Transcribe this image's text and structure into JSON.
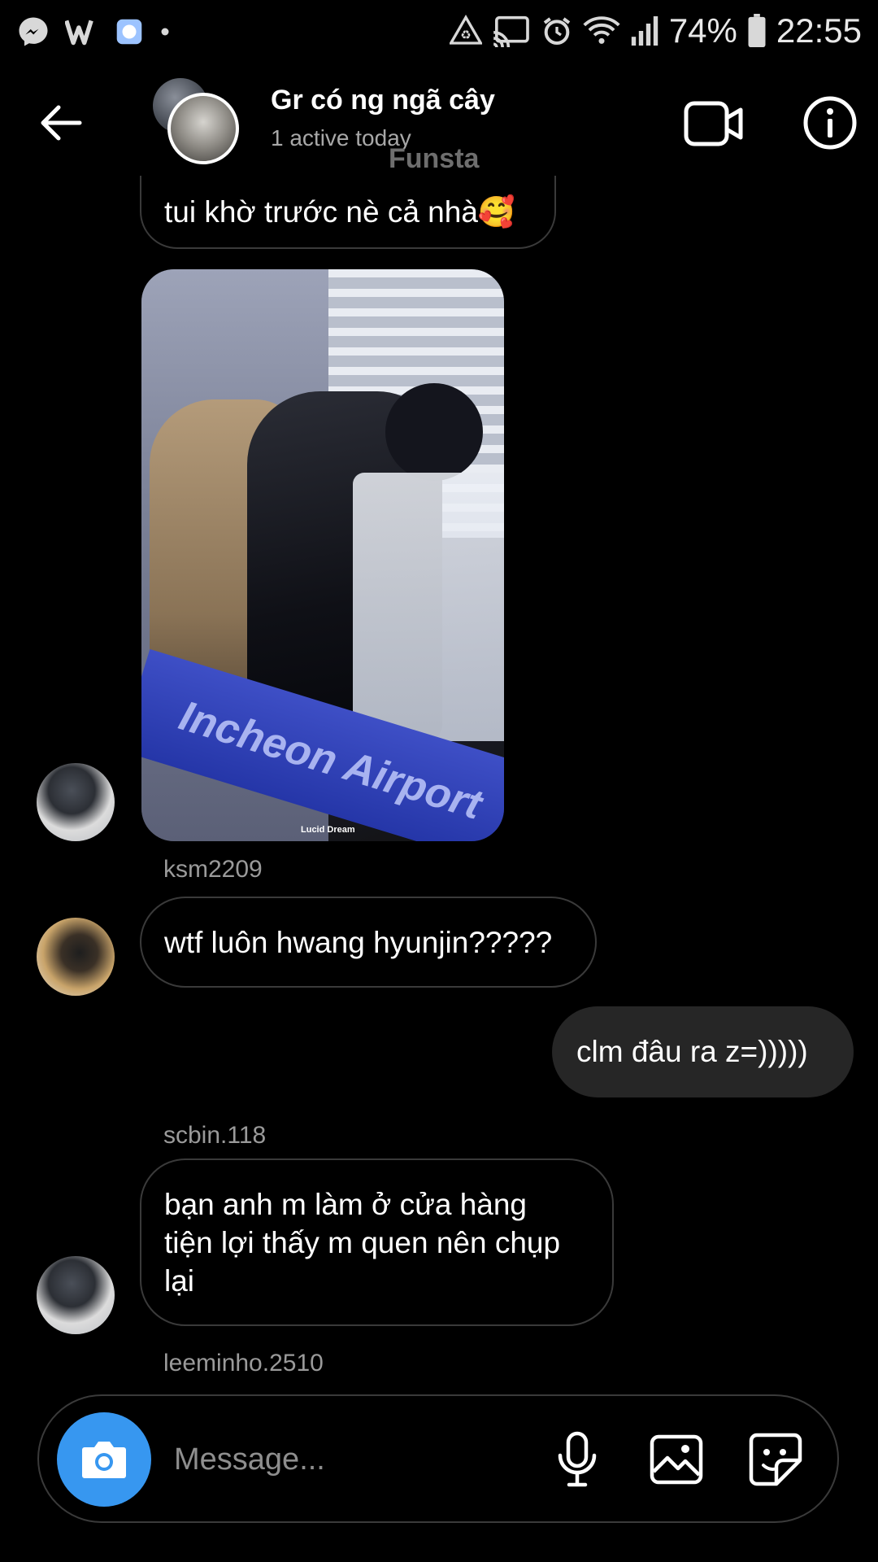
{
  "status_bar": {
    "battery": "74%",
    "time": "22:55",
    "left_icons": [
      "messenger-icon",
      "w-app-icon",
      "app-square-icon",
      "dot-icon"
    ],
    "right_icons": [
      "recycle-warning-icon",
      "cast-icon",
      "alarm-icon",
      "wifi-icon",
      "signal-icon",
      "battery-icon"
    ]
  },
  "header": {
    "title": "Gr có ng ngã cây",
    "subtitle": "1 active today",
    "overlay_label": "Funsta",
    "back_icon": "arrow-left-icon",
    "video_icon": "video-camera-icon",
    "info_icon": "info-icon"
  },
  "messages": [
    {
      "type": "text",
      "direction": "incoming",
      "text": "tui khờ trước nè cả nhà🥰"
    },
    {
      "type": "image",
      "direction": "incoming",
      "image_text": "Incheon Airport",
      "watermark": "Lucid Dream"
    },
    {
      "type": "username",
      "text": "ksm2209"
    },
    {
      "type": "text",
      "direction": "incoming",
      "text": "wtf luôn hwang hyunjin?????"
    },
    {
      "type": "text",
      "direction": "outgoing",
      "text": "clm đâu ra z=)))))"
    },
    {
      "type": "username",
      "text": "scbin.118"
    },
    {
      "type": "text",
      "direction": "incoming",
      "lines": [
        "bạn anh m làm ở cửa hàng",
        "tiện lợi thấy m quen nên chụp",
        "lại"
      ]
    },
    {
      "type": "username",
      "text": "leeminho.2510"
    }
  ],
  "composer": {
    "placeholder": "Message...",
    "camera_icon": "camera-icon",
    "mic_icon": "microphone-icon",
    "gallery_icon": "gallery-icon",
    "sticker_icon": "sticker-icon",
    "camera_button_color": "#3797f0"
  },
  "colors": {
    "background": "#000000",
    "outgoing_bubble": "#262626",
    "incoming_border": "#3a3a3a",
    "secondary_text": "#9a9a9a"
  }
}
